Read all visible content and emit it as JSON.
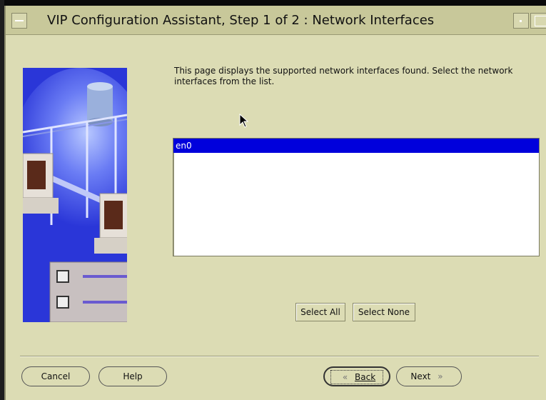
{
  "window": {
    "title": "VIP Configuration Assistant, Step 1 of 2 : Network Interfaces"
  },
  "content": {
    "instruction": "This page displays the supported network interfaces found. Select the network interfaces from the list.",
    "interfaces": [
      {
        "name": "en0",
        "selected": true
      }
    ]
  },
  "buttons": {
    "select_all": "Select All",
    "select_none": "Select None",
    "cancel": "Cancel",
    "help": "Help",
    "back": "Back",
    "next": "Next"
  },
  "colors": {
    "window_bg": "#dcdcb4",
    "selection": "#0000dc",
    "art_blue": "#2a36d8"
  }
}
